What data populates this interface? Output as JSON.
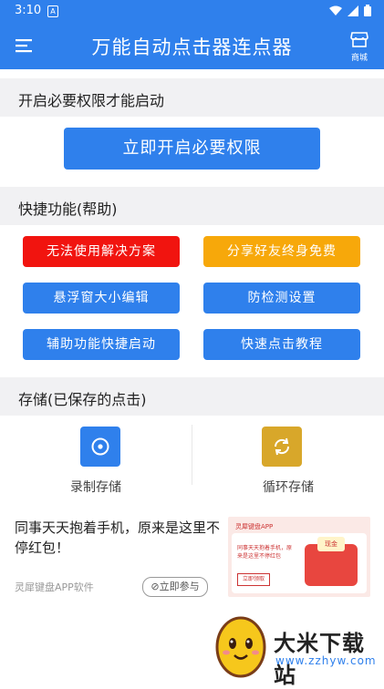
{
  "status_bar": {
    "time": "3:10",
    "notif_icon": "A"
  },
  "app_bar": {
    "title": "万能自动点击器连点器",
    "mall_label": "商城"
  },
  "permissions": {
    "heading": "开启必要权限才能启动",
    "button": "立即开启必要权限"
  },
  "quick": {
    "heading": "快捷功能(帮助)",
    "buttons": [
      {
        "label": "无法使用解决方案",
        "color": "#f1140f"
      },
      {
        "label": "分享好友终身免费",
        "color": "#f7a80a"
      },
      {
        "label": "悬浮窗大小编辑",
        "color": "#2f80ec"
      },
      {
        "label": "防检测设置",
        "color": "#2f80ec"
      },
      {
        "label": "辅助功能快捷启动",
        "color": "#2f80ec"
      },
      {
        "label": "快速点击教程",
        "color": "#2f80ec"
      }
    ]
  },
  "storage": {
    "heading": "存储(已保存的点击)",
    "items": [
      {
        "label": "录制存储",
        "color": "#2f80ec"
      },
      {
        "label": "循环存储",
        "color": "#d8a72a"
      }
    ]
  },
  "ad": {
    "text": "同事天天抱着手机，原来是这里不停红包！",
    "source": "灵犀键盘APP软件",
    "button": "立即参与",
    "image_header": "灵犀键盘APP",
    "image_text": "同事天天抱着手机，原来是这里不停红包",
    "image_button": "立即领取",
    "image_envelope": "现金"
  },
  "watermark": {
    "brand": "大米下载站",
    "url": "www.zzhyw.com"
  }
}
